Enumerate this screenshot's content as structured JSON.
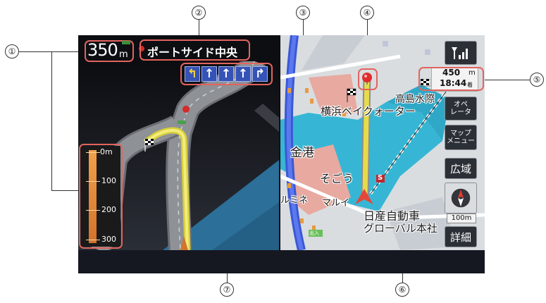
{
  "callouts": [
    "①",
    "②",
    "③",
    "④",
    "⑤",
    "⑥",
    "⑦"
  ],
  "top_bar": {
    "distance_value": "350",
    "distance_unit": "m",
    "place_name": "ポートサイド中央"
  },
  "lane_guide": {
    "lanes": [
      "↰",
      "↑",
      "↑",
      "↑",
      "↱"
    ]
  },
  "distance_gauge": {
    "ticks": [
      "0m",
      "100",
      "200",
      "300"
    ]
  },
  "destination_info": {
    "distance": "450",
    "distance_unit": "m",
    "arrival_time": "18:44",
    "time_unit": "着"
  },
  "map_labels": {
    "yokohama_bay_quarter": "横浜ベイクォーター",
    "takashima_suisou": "高島水際",
    "kinko": "金港",
    "sogo": "そごう",
    "marui": "マルイ",
    "rumine": "ルミネ",
    "nissan_line1": "日産自動車",
    "nissan_line2": "グローバル本社",
    "exit_tag": "出入",
    "s_marker": "S"
  },
  "side_menu": {
    "operator_label": "オペ\nレータ",
    "map_menu_label": "マップ\nメニュー",
    "wide_label": "広域",
    "scale_value": "100m",
    "detail_label": "詳細"
  },
  "colors": {
    "callout_border": "#e2645e",
    "route_yellow": "#e6dc4a",
    "water": "#39b7d4",
    "lane_blue": "#3552b7",
    "gauge_orange": "#e48a3a"
  }
}
